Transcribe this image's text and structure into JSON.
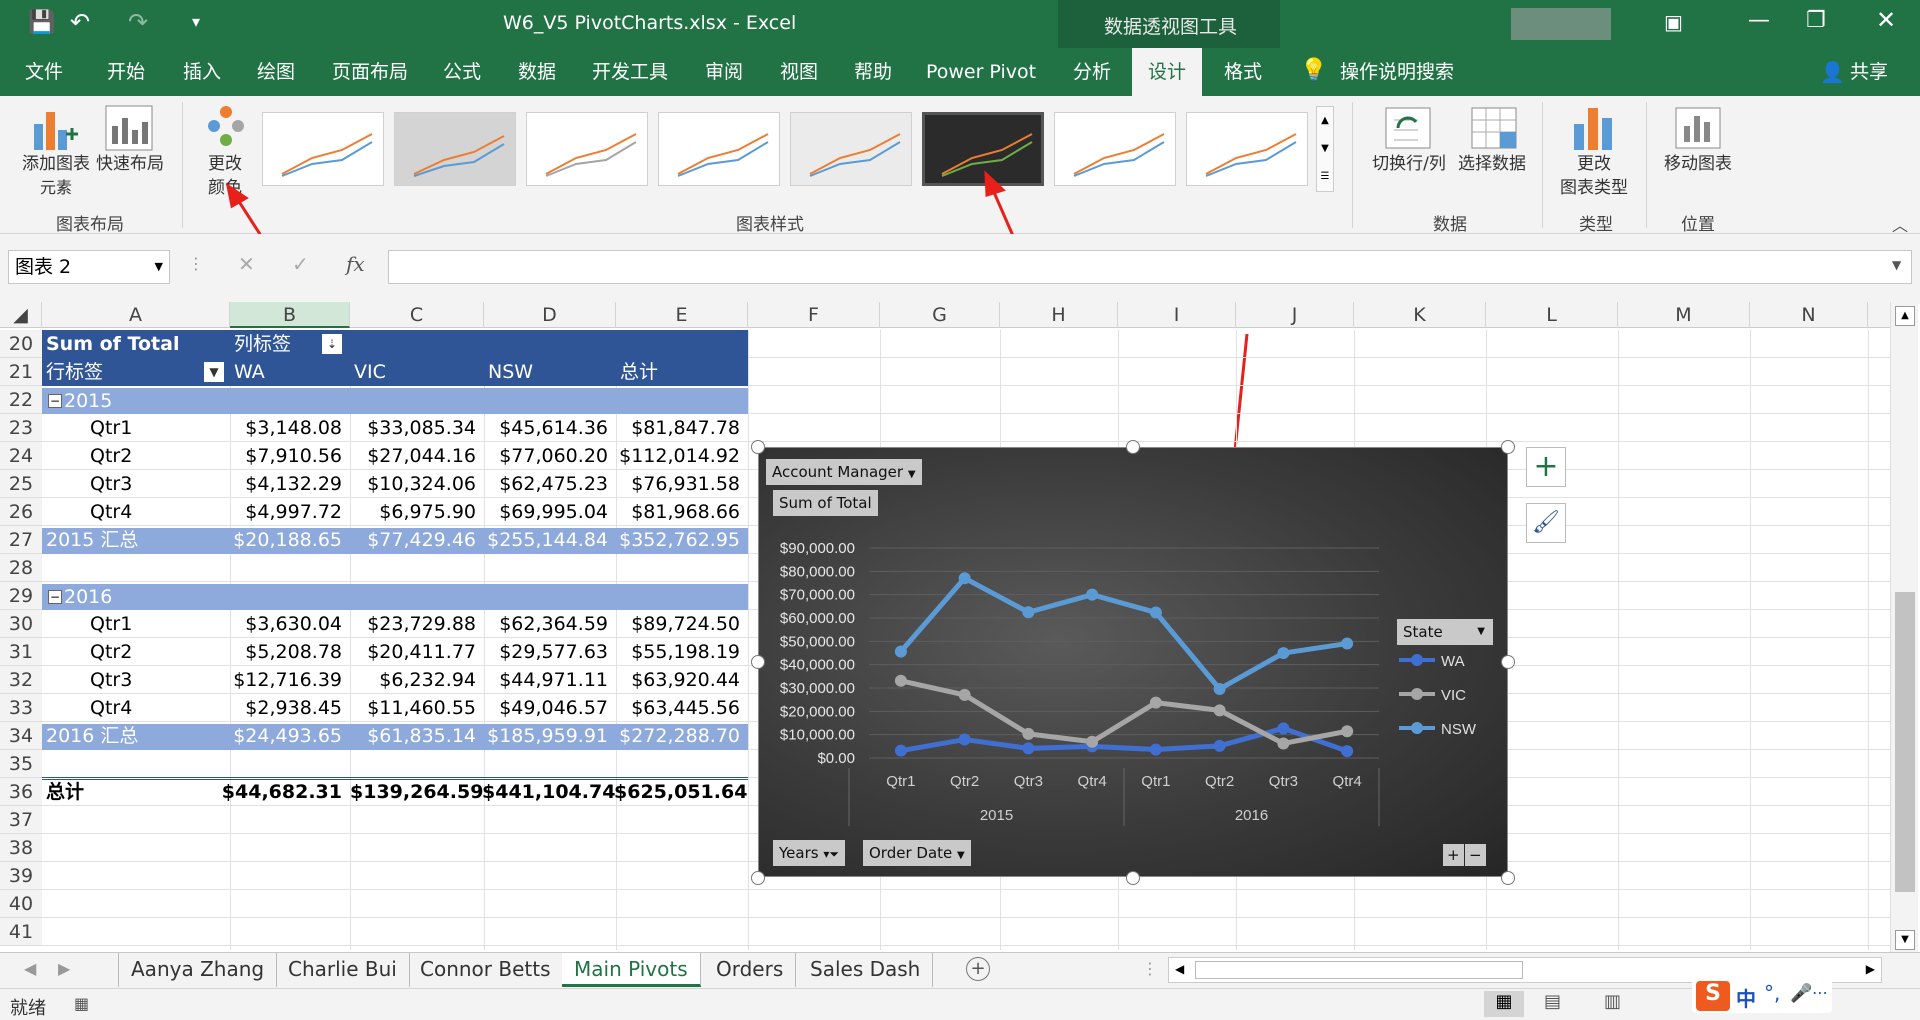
{
  "window": {
    "filename_title": "W6_V5 PivotCharts.xlsx  -  Excel",
    "context_tools": "数据透视图工具"
  },
  "ribbon_tabs": [
    "文件",
    "开始",
    "插入",
    "绘图",
    "页面布局",
    "公式",
    "数据",
    "开发工具",
    "审阅",
    "视图",
    "帮助",
    "Power Pivot",
    "分析",
    "设计",
    "格式"
  ],
  "search_label": "操作说明搜索",
  "share_label": "共享",
  "ribbon": {
    "add_element_label1": "添加图表",
    "add_element_label2": "元素",
    "quick_layout_label": "快速布局",
    "change_colors_label1": "更改",
    "change_colors_label2": "颜色",
    "group_layout": "图表布局",
    "group_styles": "图表样式",
    "switch_rowcol_label": "切换行/列",
    "select_data_label": "选择数据",
    "group_data": "数据",
    "change_type_label1": "更改",
    "change_type_label2": "图表类型",
    "group_type": "类型",
    "move_chart_label": "移动图表",
    "group_location": "位置"
  },
  "formula_bar": {
    "name_box": "图表 2",
    "fx": "fx",
    "formula": ""
  },
  "columns": [
    "A",
    "B",
    "C",
    "D",
    "E",
    "F",
    "G",
    "H",
    "I",
    "J",
    "K",
    "L",
    "M",
    "N"
  ],
  "rows": [
    "20",
    "21",
    "22",
    "23",
    "24",
    "25",
    "26",
    "27",
    "28",
    "29",
    "30",
    "31",
    "32",
    "33",
    "34",
    "35",
    "36",
    "37",
    "38",
    "39",
    "40",
    "41"
  ],
  "pivot": {
    "header_sum": "Sum of Total",
    "col_labels": "列标签",
    "row_labels": "行标签",
    "col_headers": [
      "WA",
      "VIC",
      "NSW",
      "总计"
    ],
    "year2015": "2015",
    "year2016": "2016",
    "rows2015": [
      {
        "q": "Qtr1",
        "v": [
          "$3,148.08",
          "$33,085.34",
          "$45,614.36",
          "$81,847.78"
        ]
      },
      {
        "q": "Qtr2",
        "v": [
          "$7,910.56",
          "$27,044.16",
          "$77,060.20",
          "$112,014.92"
        ]
      },
      {
        "q": "Qtr3",
        "v": [
          "$4,132.29",
          "$10,324.06",
          "$62,475.23",
          "$76,931.58"
        ]
      },
      {
        "q": "Qtr4",
        "v": [
          "$4,997.72",
          "$6,975.90",
          "$69,995.04",
          "$81,968.66"
        ]
      }
    ],
    "total2015": {
      "label": "2015 汇总",
      "v": [
        "$20,188.65",
        "$77,429.46",
        "$255,144.84",
        "$352,762.95"
      ]
    },
    "rows2016": [
      {
        "q": "Qtr1",
        "v": [
          "$3,630.04",
          "$23,729.88",
          "$62,364.59",
          "$89,724.50"
        ]
      },
      {
        "q": "Qtr2",
        "v": [
          "$5,208.78",
          "$20,411.77",
          "$29,577.63",
          "$55,198.19"
        ]
      },
      {
        "q": "Qtr3",
        "v": [
          "$12,716.39",
          "$6,232.94",
          "$44,971.11",
          "$63,920.44"
        ]
      },
      {
        "q": "Qtr4",
        "v": [
          "$2,938.45",
          "$11,460.55",
          "$49,046.57",
          "$63,445.56"
        ]
      }
    ],
    "total2016": {
      "label": "2016 汇总",
      "v": [
        "$24,493.65",
        "$61,835.14",
        "$185,959.91",
        "$272,288.70"
      ]
    },
    "grand": {
      "label": "总计",
      "v": [
        "$44,682.31",
        "$139,264.59",
        "$441,104.74",
        "$625,051.64"
      ]
    }
  },
  "chart_buttons": {
    "account_manager": "Account Manager",
    "sum_of_total": "Sum of Total",
    "state": "State",
    "years": "Years",
    "order_date": "Order Date"
  },
  "chart_data": {
    "type": "line",
    "categories": [
      "Qtr1",
      "Qtr2",
      "Qtr3",
      "Qtr4",
      "Qtr1",
      "Qtr2",
      "Qtr3",
      "Qtr4"
    ],
    "groups": [
      "2015",
      "2016"
    ],
    "ylim": [
      0,
      90000
    ],
    "ytick_labels": [
      "$90,000.00",
      "$80,000.00",
      "$70,000.00",
      "$60,000.00",
      "$50,000.00",
      "$40,000.00",
      "$30,000.00",
      "$20,000.00",
      "$10,000.00",
      "$0.00"
    ],
    "series": [
      {
        "name": "WA",
        "color": "#3f6fd1",
        "values": [
          3148.08,
          7910.56,
          4132.29,
          4997.72,
          3630.04,
          5208.78,
          12716.39,
          2938.45
        ]
      },
      {
        "name": "VIC",
        "color": "#a6a6a6",
        "values": [
          33085.34,
          27044.16,
          10324.06,
          6975.9,
          23729.88,
          20411.77,
          6232.94,
          11460.55
        ]
      },
      {
        "name": "NSW",
        "color": "#5b9bd5",
        "values": [
          45614.36,
          77060.2,
          62475.23,
          69995.04,
          62364.59,
          29577.63,
          44971.11,
          49046.57
        ]
      }
    ],
    "legend_position": "right",
    "grid": true
  },
  "sheets": [
    "Aanya Zhang",
    "Charlie Bui",
    "Connor Betts",
    "Main Pivots",
    "Orders",
    "Sales Dash"
  ],
  "active_sheet": "Main Pivots",
  "status": {
    "ready": "就绪"
  },
  "colors": {
    "excel_green": "#217346",
    "pivot_header": "#2f5597",
    "pivot_band": "#8ea9db"
  }
}
